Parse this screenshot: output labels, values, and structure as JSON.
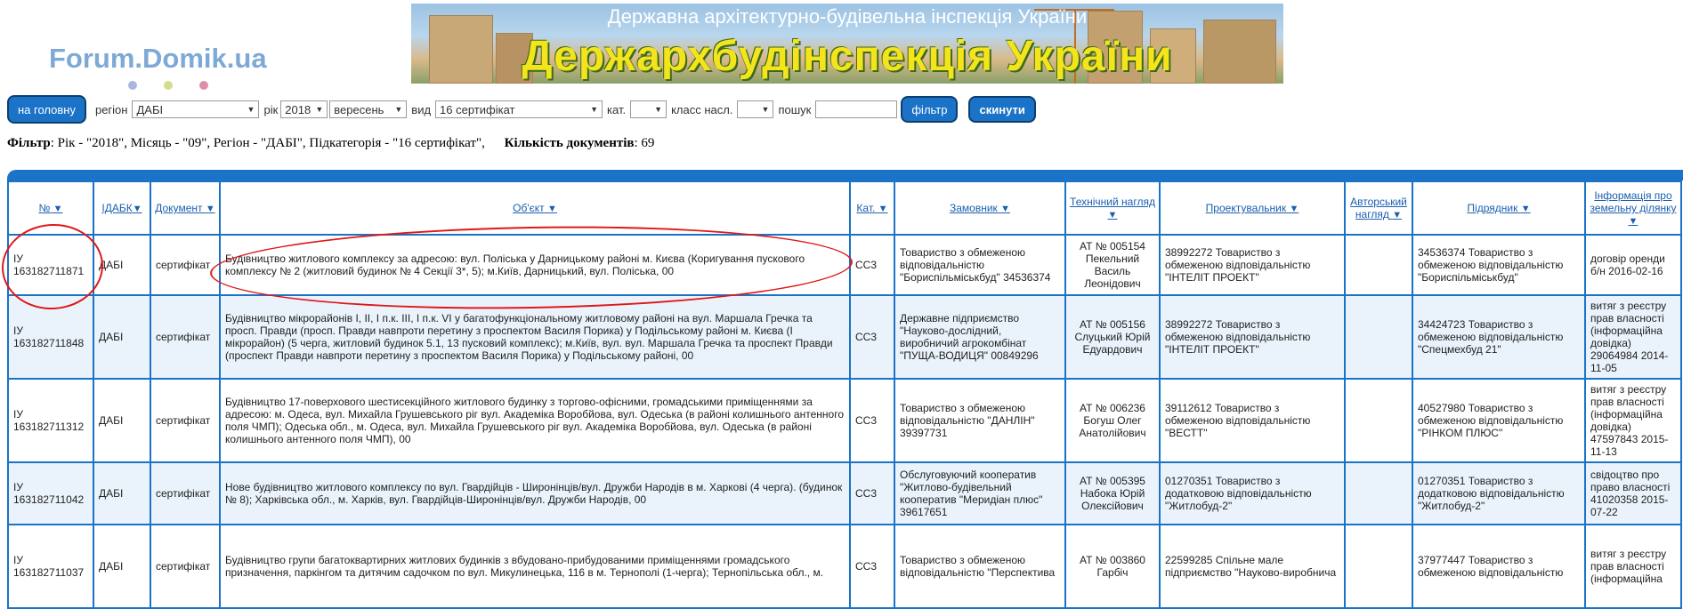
{
  "logo": {
    "text": "Forum.Domik.ua",
    "dots": [
      "#aab6e0",
      "#d6dc8c",
      "#df8fa9"
    ]
  },
  "banner": {
    "subtitle": "Державна архітектурно-будівельна інспекція України",
    "title": "Держархбудінспекція України"
  },
  "controls": {
    "home_button": "на головну",
    "region_label": "регіон",
    "region_value": "ДАБІ",
    "year_label": "рік",
    "year_value": "2018",
    "month_value": "вересень",
    "type_label": "вид",
    "type_value": "16 сертифікат",
    "category_label": "кат.",
    "category_value": "",
    "class_label": "класс насл.",
    "class_value": "",
    "search_label": "пошук",
    "search_value": "",
    "filter_button": "фільтр",
    "reset_button": "скинути"
  },
  "filter_info": {
    "filter_word": "Фільтр",
    "filter_text": ": Рік - \"2018\", Місяць - \"09\", Регіон - \"ДАБІ\", Підкатегорія - \"16 сертифікат\",",
    "count_word": "Кількість документів",
    "count_text": ": 69"
  },
  "table": {
    "headers": [
      "№",
      "ІДАБК",
      "Документ",
      "Об'єкт",
      "Кат.",
      "Замовник",
      "Технічний нагляд",
      "Проектувальник",
      "Авторський нагляд",
      "Підрядник",
      "Інформація про земельну ділянку"
    ],
    "rows": [
      {
        "num": "ІУ 163182711871",
        "idabk": "ДАБІ",
        "doc": "сертифікат",
        "object": "Будівництво житлового комплексу за адресою: вул. Поліська у Дарницькому районі м. Києва (Коригування пускового комплексу № 2 (житловий будинок № 4 Секції 3*, 5); м.Київ, Дарницький, вул. Поліська, 00",
        "cat": "СС3",
        "customer": "Товариство з обмеженою відповідальністю \"Бориспільміськбуд\" 34536374",
        "supervision": "АТ № 005154 Пекельний Василь Леонідович",
        "designer": "38992272 Товариство з обмеженою відповідальністю \"ІНТЕЛІТ ПРОЕКТ\"",
        "author": "",
        "contractor": "34536374 Товариство з обмеженою відповідальністю \"Бориспільміськбуд\"",
        "land": "договір оренди б/н 2016-02-16"
      },
      {
        "num": "ІУ 163182711848",
        "idabk": "ДАБІ",
        "doc": "сертифікат",
        "object": "Будівництво мікрорайонів І, ІІ, І п.к. ІІІ, І п.к. VІ у багатофункціональному житловому районі на вул. Маршала Гречка та просп. Правди (просп. Правди навпроти перетину з проспектом Василя Порика) у Подільському районі м. Києва (І мікрорайон) (5 черга, житловий будинок 5.1, 13 пусковий комплекс); м.Київ, вул. вул. Маршала Гречка та проспект Правди (проспект Правди навпроти перетину з проспектом Василя Порика) у Подільському районі, 00",
        "cat": "СС3",
        "customer": "Державне підприємство \"Науково-дослідний, виробничий агрокомбінат \"ПУЩА-ВОДИЦЯ\" 00849296",
        "supervision": "АТ № 005156 Слуцький Юрій Едуардович",
        "designer": "38992272 Товариство з обмеженою відповідальністю \"ІНТЕЛІТ ПРОЕКТ\"",
        "author": "",
        "contractor": "34424723 Товариство з обмеженою відповідальністю \"Спецмехбуд 21\"",
        "land": "витяг з реєстру прав власності (інформаційна довідка) 29064984 2014-11-05"
      },
      {
        "num": "ІУ 163182711312",
        "idabk": "ДАБІ",
        "doc": "сертифікат",
        "object": "Будівництво 17-поверхового шестисекційного житлового будинку з торгово-офісними, громадськими приміщеннями за адресою: м. Одеса, вул. Михайла Грушевського ріг вул. Академіка Воробйова, вул. Одеська (в районі колишнього антенного поля ЧМП); Одеська обл., м. Одеса, вул. Михайла Грушевського ріг вул. Академіка Воробйова, вул. Одеська (в районі колишнього антенного поля ЧМП), 00",
        "cat": "СС3",
        "customer": "Товариство з обмеженою відповідальністю \"ДАНЛІН\" 39397731",
        "supervision": "АТ № 006236 Богуш Олег Анатолійович",
        "designer": "39112612 Товариство з обмеженою відповідальністю \"ВЕСТТ\"",
        "author": "",
        "contractor": "40527980 Товариство з обмеженою відповідальністю \"РІНКОМ ПЛЮС\"",
        "land": "витяг з реєстру прав власності (інформаційна довідка) 47597843 2015-11-13"
      },
      {
        "num": "ІУ 163182711042",
        "idabk": "ДАБІ",
        "doc": "сертифікат",
        "object": "Нове будівництво житлового комплексу по вул. Гвардійців - Широнінців/вул. Дружби Народів в м. Харкові (4 черга). (будинок № 8); Харківська обл., м. Харків, вул. Гвардійців-Широнінців/вул. Дружби Народів, 00",
        "cat": "СС3",
        "customer": "Обслуговуючий кооператив \"Житлово-будівельний кооператив \"Меридіан плюс\" 39617651",
        "supervision": "АТ № 005395 Набока Юрій Олексійович",
        "designer": "01270351 Товариство з додатковою відповідальністю \"Житлобуд-2\"",
        "author": "",
        "contractor": "01270351 Товариство з додатковою відповідальністю \"Житлобуд-2\"",
        "land": "свідоцтво про право власності 41020358 2015-07-22"
      },
      {
        "num": "ІУ 163182711037",
        "idabk": "ДАБІ",
        "doc": "сертифікат",
        "object": "Будівництво групи багатоквартирних житлових будинків з вбудовано-прибудованими приміщеннями громадського призначення, паркінгом та дитячим садочком по вул. Микулинецька, 116 в м. Тернополі (1-черга); Тернопільська обл., м.",
        "cat": "СС3",
        "customer": "Товариство з обмеженою відповідальністю \"Перспектива",
        "supervision": "АТ № 003860 Гарбіч",
        "designer": "22599285 Спільне мале підприємство \"Науково-виробнича",
        "author": "",
        "contractor": "37977447 Товариство з обмеженою відповідальністю",
        "land": "витяг з реєстру прав власності (інформаційна"
      }
    ]
  }
}
